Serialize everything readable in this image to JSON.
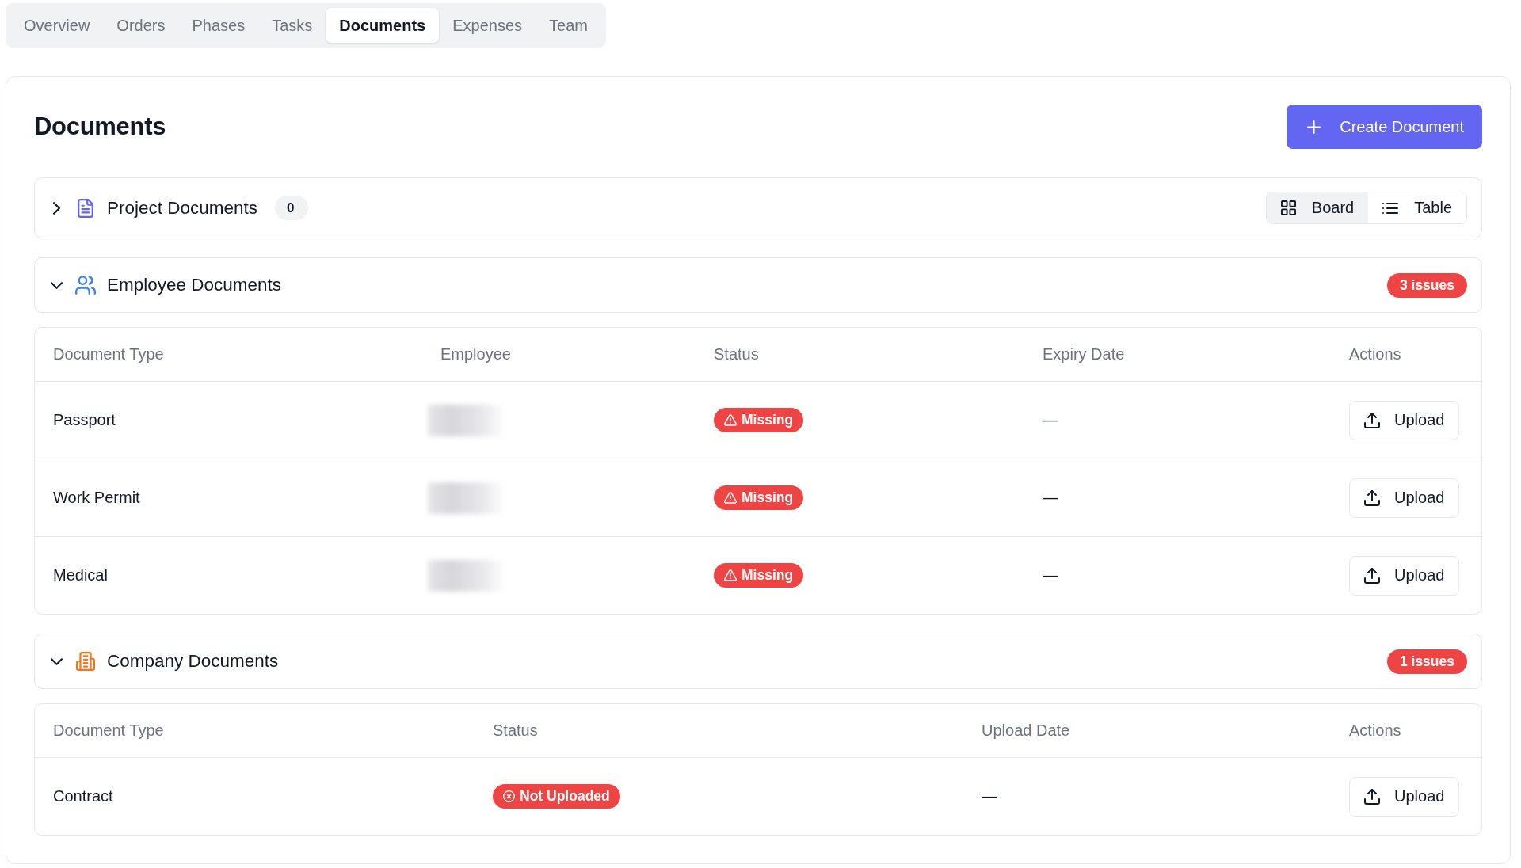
{
  "tabs": [
    {
      "label": "Overview",
      "selected": false
    },
    {
      "label": "Orders",
      "selected": false
    },
    {
      "label": "Phases",
      "selected": false
    },
    {
      "label": "Tasks",
      "selected": false
    },
    {
      "label": "Documents",
      "selected": true
    },
    {
      "label": "Expenses",
      "selected": false
    },
    {
      "label": "Team",
      "selected": false
    }
  ],
  "page": {
    "title": "Documents",
    "create_button": "Create Document"
  },
  "sections": [
    {
      "kind": "project",
      "title": "Project Documents",
      "expanded": false,
      "count": "0",
      "view_toggle": [
        {
          "kind": "board",
          "label": "Board",
          "selected": true
        },
        {
          "kind": "table",
          "label": "Table",
          "selected": false
        }
      ]
    },
    {
      "kind": "employee",
      "title": "Employee Documents",
      "expanded": true,
      "issues": "3 issues",
      "table": {
        "columns": [
          "Document Type",
          "Employee",
          "Status",
          "Expiry Date",
          "Actions"
        ],
        "rows": [
          {
            "cells": [
              {
                "kind": "text",
                "text": "Passport"
              },
              {
                "kind": "redacted"
              },
              {
                "kind": "missing",
                "text": "Missing"
              },
              {
                "kind": "text",
                "text": "—"
              },
              {
                "kind": "button",
                "text": "Upload"
              }
            ]
          },
          {
            "cells": [
              {
                "kind": "text",
                "text": "Work Permit"
              },
              {
                "kind": "redacted"
              },
              {
                "kind": "missing",
                "text": "Missing"
              },
              {
                "kind": "text",
                "text": "—"
              },
              {
                "kind": "button",
                "text": "Upload"
              }
            ]
          },
          {
            "cells": [
              {
                "kind": "text",
                "text": "Medical"
              },
              {
                "kind": "redacted"
              },
              {
                "kind": "missing",
                "text": "Missing"
              },
              {
                "kind": "text",
                "text": "—"
              },
              {
                "kind": "button",
                "text": "Upload"
              }
            ]
          }
        ]
      }
    },
    {
      "kind": "company",
      "title": "Company Documents",
      "expanded": true,
      "issues": "1 issues",
      "table": {
        "columns": [
          "Document Type",
          "Status",
          "Upload Date",
          "Actions"
        ],
        "rows": [
          {
            "cells": [
              {
                "kind": "text",
                "text": "Contract"
              },
              {
                "kind": "not-uploaded",
                "text": "Not Uploaded"
              },
              {
                "kind": "text",
                "text": "—"
              },
              {
                "kind": "button",
                "text": "Upload"
              }
            ]
          }
        ]
      }
    }
  ]
}
